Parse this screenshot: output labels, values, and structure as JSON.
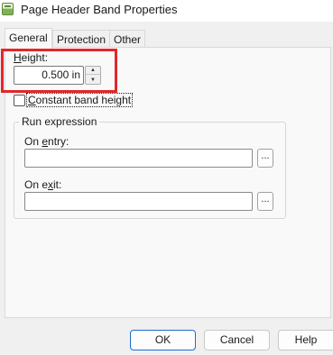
{
  "window": {
    "title": "Page Header Band Properties",
    "icon": "band-properties-icon"
  },
  "tabs": [
    {
      "label": "General",
      "active": true
    },
    {
      "label": "Protection",
      "active": false
    },
    {
      "label": "Other",
      "active": false
    }
  ],
  "general": {
    "height_label_pre": "",
    "height_label_access": "H",
    "height_label_post": "eight:",
    "height_value": "0.500 in",
    "constant_label_pre": "",
    "constant_label_access": "C",
    "constant_label_post": "onstant band height",
    "constant_checked": false,
    "run_expression_title": "Run expression",
    "on_entry_label_pre": "On ",
    "on_entry_label_access": "e",
    "on_entry_label_post": "ntry:",
    "on_entry_value": "",
    "on_exit_label_pre": "On e",
    "on_exit_label_access": "x",
    "on_exit_label_post": "it:",
    "on_exit_value": "",
    "browse_label": "..."
  },
  "buttons": {
    "ok": "OK",
    "cancel": "Cancel",
    "help": "Help"
  },
  "colors": {
    "highlight": "#e3262a",
    "default_button_border": "#1c6cd0"
  }
}
